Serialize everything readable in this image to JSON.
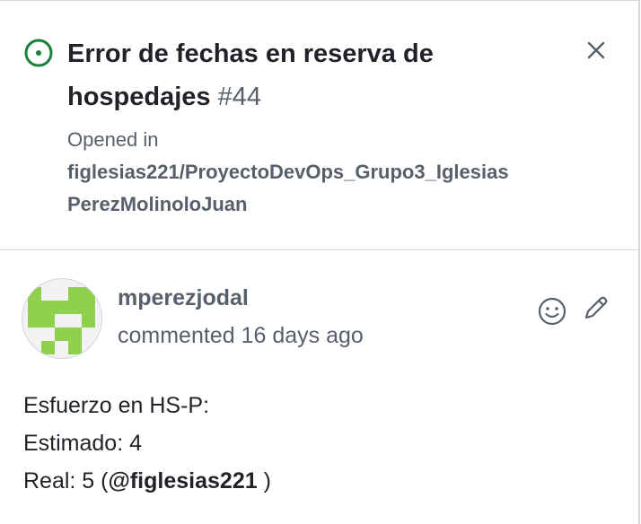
{
  "issue": {
    "title": "Error de fechas en reserva de hospedajes",
    "number": "#44",
    "status_color": "#1a7f37",
    "opened_in_label": "Opened in",
    "repository": "figlesias221/ProyectoDevOps_Grupo3_IglesiasPerezMolinoloJuan",
    "close_icon": "close-icon"
  },
  "comment": {
    "author": "mperezjodal",
    "meta": "commented 16 days ago",
    "avatar_color": "#8fd14f",
    "body": {
      "line1": "Esfuerzo en HS-P:",
      "line2": "Estimado: 4",
      "line3_prefix": "Real: 5 (",
      "mention": "@figlesias221",
      "line3_suffix": " )"
    },
    "actions": [
      "smiley-icon",
      "pencil-icon"
    ]
  }
}
